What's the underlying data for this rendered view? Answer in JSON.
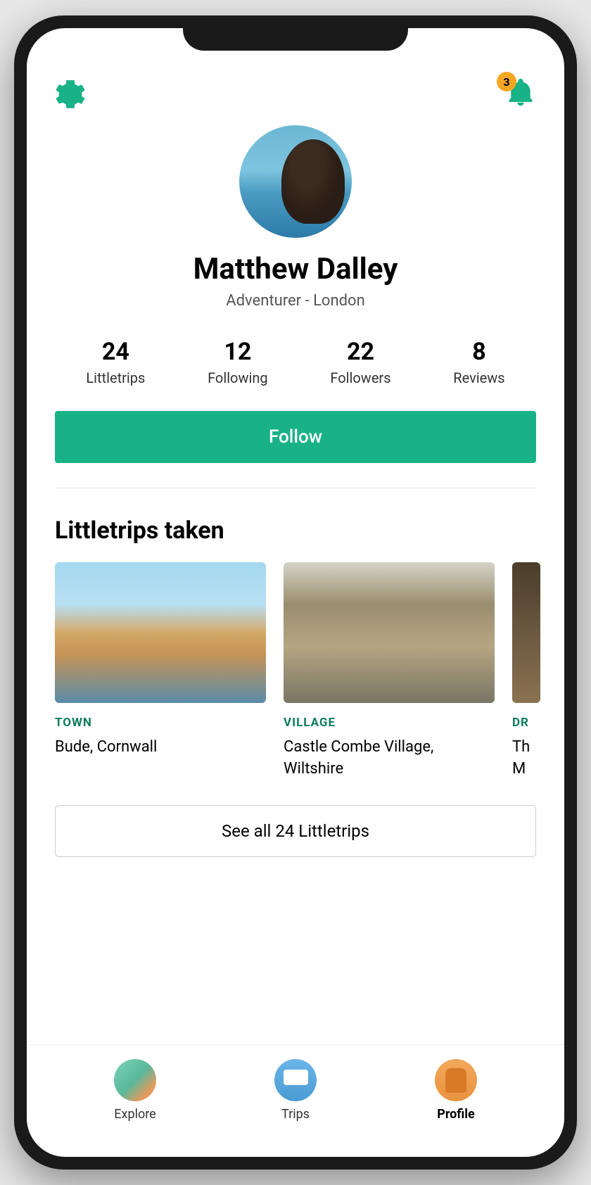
{
  "notifications": {
    "count": "3"
  },
  "profile": {
    "name": "Matthew Dalley",
    "subtitle": "Adventurer - London"
  },
  "stats": [
    {
      "value": "24",
      "label": "Littletrips"
    },
    {
      "value": "12",
      "label": "Following"
    },
    {
      "value": "22",
      "label": "Followers"
    },
    {
      "value": "8",
      "label": "Reviews"
    }
  ],
  "follow_button": "Follow",
  "trips_section": {
    "title": "Littletrips taken",
    "see_all_label": "See all 24 Littletrips",
    "trips": [
      {
        "category": "TOWN",
        "name": "Bude, Cornwall"
      },
      {
        "category": "VILLAGE",
        "name": "Castle Combe Village, Wiltshire"
      },
      {
        "category": "DR",
        "name": "Th M"
      }
    ]
  },
  "bottom_nav": [
    {
      "label": "Explore",
      "active": false
    },
    {
      "label": "Trips",
      "active": false
    },
    {
      "label": "Profile",
      "active": true
    }
  ]
}
